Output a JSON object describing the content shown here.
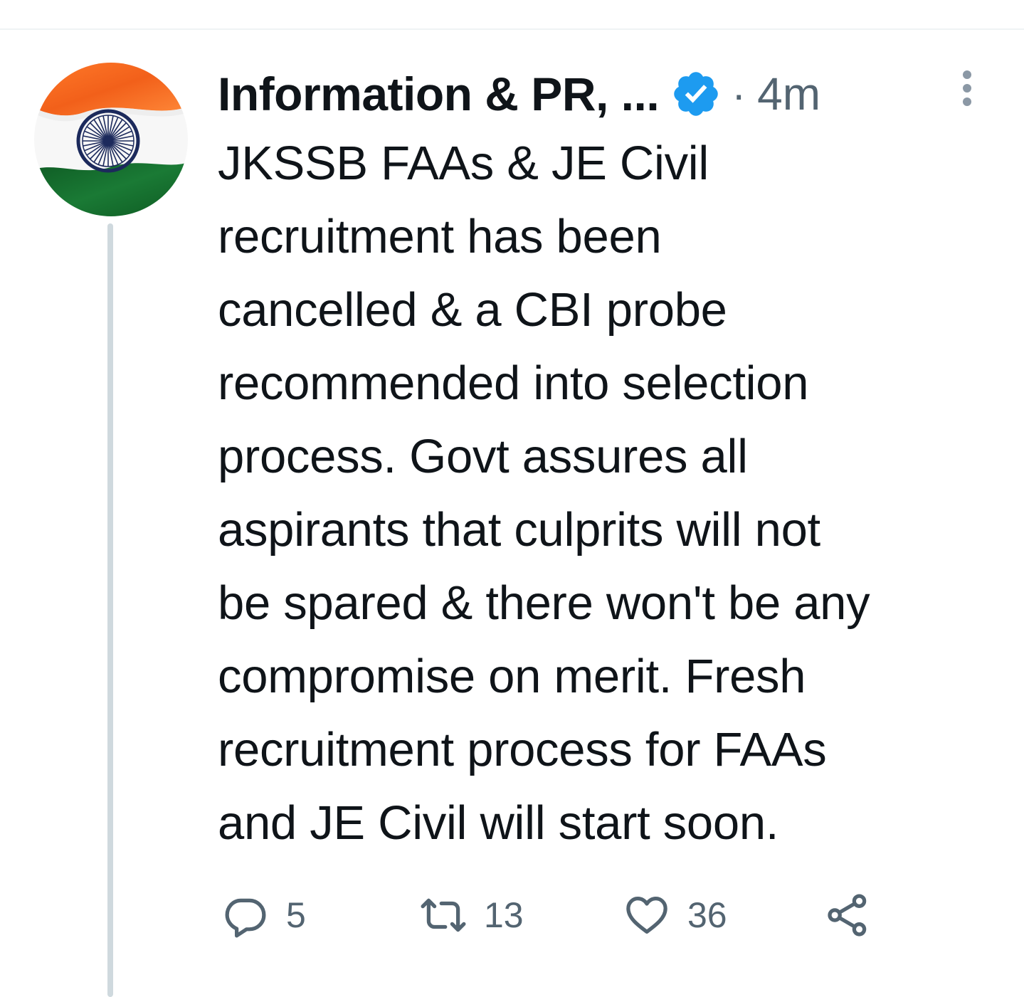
{
  "tweet": {
    "author": {
      "display_name": "Information & PR, ...",
      "verified": true,
      "avatar_icon": "india-flag-icon"
    },
    "separator": "·",
    "timestamp": "4m",
    "text_lines": [
      "JKSSB FAAs & JE Civil",
      "recruitment has been",
      "cancelled & a CBI probe",
      "recommended into selection",
      "process. Govt assures all",
      "aspirants that culprits will not",
      "be spared & there won't be any",
      "compromise on merit. Fresh",
      "recruitment process for FAAs",
      "and JE Civil will start soon."
    ],
    "actions": {
      "reply_count": "5",
      "retweet_count": "13",
      "like_count": "36"
    }
  },
  "colors": {
    "text": "#0f1419",
    "secondary": "#536471",
    "verified_blue": "#1d9bf0",
    "thread_line": "#cfd9de",
    "flag_saffron": "#ff6a1f",
    "flag_green": "#146b2c",
    "chakra_navy": "#1c2a5c"
  }
}
